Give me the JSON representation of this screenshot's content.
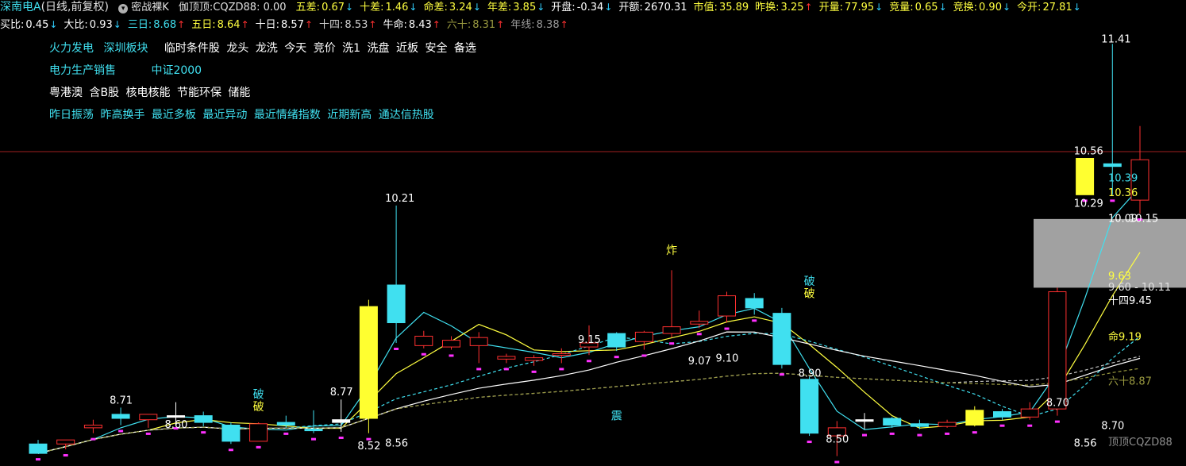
{
  "header": {
    "title": "深南电A",
    "period": "(日线,前复权)",
    "mode": "密战裸K",
    "formula_label": "伽顶顶:",
    "formula_value": "CQZD88: 0.00",
    "stats_row1": [
      {
        "label": "五差:",
        "value": "0.67",
        "dir": "down",
        "color": "#ffff40"
      },
      {
        "label": "十差:",
        "value": "1.46",
        "dir": "down",
        "color": "#ffff40"
      },
      {
        "label": "命差:",
        "value": "3.24",
        "dir": "down",
        "color": "#ffff40"
      },
      {
        "label": "年差:",
        "value": "3.85",
        "dir": "down",
        "color": "#ffff40"
      },
      {
        "label": "开盘:",
        "value": "-0.34",
        "dir": "down",
        "color": "#ffffff"
      },
      {
        "label": "开额:",
        "value": "2670.31",
        "dir": "",
        "color": "#ffffff"
      },
      {
        "label": "市值:",
        "value": "35.89",
        "dir": "",
        "color": "#ffff40"
      },
      {
        "label": "昨换:",
        "value": "3.25",
        "dir": "up",
        "color": "#ffff40"
      },
      {
        "label": "开量:",
        "value": "77.95",
        "dir": "down",
        "color": "#ffff40"
      },
      {
        "label": "竞量:",
        "value": "0.65",
        "dir": "down",
        "color": "#ffff40"
      },
      {
        "label": "竞换:",
        "value": "0.90",
        "dir": "down",
        "color": "#ffff40"
      },
      {
        "label": "今开:",
        "value": "27.81",
        "dir": "down",
        "color": "#ffff40"
      }
    ],
    "stats_row2": [
      {
        "label": "买比:",
        "value": "0.45",
        "dir": "down",
        "color": "#ffffff"
      },
      {
        "label": "大比:",
        "value": "0.93",
        "dir": "down",
        "color": "#ffffff"
      },
      {
        "label": "三日:",
        "value": "8.68",
        "dir": "up",
        "color": "#40e0f0"
      },
      {
        "label": "五日:",
        "value": "8.64",
        "dir": "up",
        "color": "#ffff40"
      },
      {
        "label": "十日:",
        "value": "8.57",
        "dir": "up",
        "color": "#ffffff"
      },
      {
        "label": "十四:",
        "value": "8.53",
        "dir": "up",
        "color": "#d0d0d0"
      },
      {
        "label": "牛命:",
        "value": "8.43",
        "dir": "up",
        "color": "#ffffff"
      },
      {
        "label": "六十:",
        "value": "8.31",
        "dir": "up",
        "color": "#9a9a40"
      },
      {
        "label": "年线:",
        "value": "8.38",
        "dir": "up",
        "color": "#9a9a9a"
      }
    ]
  },
  "tags": {
    "line1_cyan": [
      "火力发电",
      "深圳板块"
    ],
    "line1_white": [
      "临时条件股",
      "龙头",
      "龙洗",
      "今天",
      "竞价",
      "洗1",
      "洗盘",
      "近板",
      "安全",
      "备选"
    ],
    "line2_cyan": [
      "电力生产销售",
      "中证2000"
    ],
    "line3_white": [
      "粤港澳",
      "含B股",
      "核电核能",
      "节能环保",
      "储能"
    ],
    "line4_cyan": [
      "昨日振荡",
      "昨高换手",
      "最近多板",
      "最近异动",
      "最近情绪指数",
      "近期新高",
      "通达信热股"
    ]
  },
  "chart_data": {
    "type": "candlestick",
    "ylim": [
      8.3,
      11.5
    ],
    "candles": [
      {
        "o": 8.44,
        "h": 8.47,
        "l": 8.37,
        "c": 8.37,
        "color": "cyan"
      },
      {
        "o": 8.44,
        "h": 8.47,
        "l": 8.4,
        "c": 8.47,
        "color": "red"
      },
      {
        "o": 8.56,
        "h": 8.62,
        "l": 8.52,
        "c": 8.58,
        "color": "red"
      },
      {
        "o": 8.66,
        "h": 8.71,
        "l": 8.58,
        "c": 8.63,
        "color": "cyan"
      },
      {
        "o": 8.62,
        "h": 8.66,
        "l": 8.56,
        "c": 8.66,
        "color": "red"
      },
      {
        "o": 8.65,
        "h": 8.75,
        "l": 8.6,
        "c": 8.64,
        "color": "white"
      },
      {
        "o": 8.65,
        "h": 8.68,
        "l": 8.57,
        "c": 8.6,
        "color": "cyan"
      },
      {
        "o": 8.58,
        "h": 8.6,
        "l": 8.44,
        "c": 8.46,
        "color": "cyan"
      },
      {
        "o": 8.46,
        "h": 8.6,
        "l": 8.46,
        "c": 8.59,
        "color": "red"
      },
      {
        "o": 8.6,
        "h": 8.65,
        "l": 8.56,
        "c": 8.58,
        "color": "cyan"
      },
      {
        "o": 8.55,
        "h": 8.69,
        "l": 8.52,
        "c": 8.55,
        "color": "cyan"
      },
      {
        "o": 8.62,
        "h": 8.77,
        "l": 8.53,
        "c": 8.6,
        "color": "white"
      },
      {
        "o": 8.63,
        "h": 9.51,
        "l": 8.52,
        "c": 9.46,
        "color": "yellow"
      },
      {
        "o": 9.34,
        "h": 10.21,
        "l": 9.19,
        "c": 9.62,
        "color": "cyan"
      },
      {
        "o": 9.24,
        "h": 9.28,
        "l": 9.15,
        "c": 9.17,
        "color": "red"
      },
      {
        "o": 9.21,
        "h": 9.24,
        "l": 9.14,
        "c": 9.16,
        "color": "red"
      },
      {
        "o": 9.17,
        "h": 9.27,
        "l": 9.04,
        "c": 9.23,
        "color": "red"
      },
      {
        "o": 9.09,
        "h": 9.11,
        "l": 9.04,
        "c": 9.07,
        "color": "red"
      },
      {
        "o": 9.08,
        "h": 9.1,
        "l": 9.02,
        "c": 9.06,
        "color": "red"
      },
      {
        "o": 9.1,
        "h": 9.15,
        "l": 9.04,
        "c": 9.11,
        "color": "red"
      },
      {
        "o": 9.16,
        "h": 9.32,
        "l": 9.1,
        "c": 9.19,
        "color": "red"
      },
      {
        "o": 9.16,
        "h": 9.27,
        "l": 9.13,
        "c": 9.26,
        "color": "cyan"
      },
      {
        "o": 9.2,
        "h": 9.28,
        "l": 9.14,
        "c": 9.27,
        "color": "red"
      },
      {
        "o": 9.26,
        "h": 9.73,
        "l": 9.23,
        "c": 9.31,
        "color": "red"
      },
      {
        "o": 9.33,
        "h": 9.43,
        "l": 9.3,
        "c": 9.35,
        "color": "red"
      },
      {
        "o": 9.39,
        "h": 9.57,
        "l": 9.34,
        "c": 9.54,
        "color": "red"
      },
      {
        "o": 9.52,
        "h": 9.56,
        "l": 9.4,
        "c": 9.45,
        "color": "cyan"
      },
      {
        "o": 9.41,
        "h": 9.45,
        "l": 9.0,
        "c": 9.03,
        "color": "cyan"
      },
      {
        "o": 8.92,
        "h": 8.94,
        "l": 8.5,
        "c": 8.52,
        "color": "cyan"
      },
      {
        "o": 8.56,
        "h": 8.61,
        "l": 8.35,
        "c": 8.5,
        "color": "red"
      },
      {
        "o": 8.62,
        "h": 8.67,
        "l": 8.55,
        "c": 8.62,
        "color": "white"
      },
      {
        "o": 8.63,
        "h": 8.64,
        "l": 8.56,
        "c": 8.58,
        "color": "cyan"
      },
      {
        "o": 8.59,
        "h": 8.62,
        "l": 8.55,
        "c": 8.57,
        "color": "cyan"
      },
      {
        "o": 8.57,
        "h": 8.62,
        "l": 8.56,
        "c": 8.6,
        "color": "red"
      },
      {
        "o": 8.58,
        "h": 8.72,
        "l": 8.57,
        "c": 8.69,
        "color": "yellow"
      },
      {
        "o": 8.68,
        "h": 8.7,
        "l": 8.62,
        "c": 8.64,
        "color": "cyan"
      },
      {
        "o": 8.64,
        "h": 8.75,
        "l": 8.62,
        "c": 8.7,
        "color": "red"
      },
      {
        "o": 8.7,
        "h": 9.6,
        "l": 8.65,
        "c": 9.57,
        "color": "red"
      },
      {
        "o": 10.56,
        "h": 10.56,
        "l": 10.29,
        "c": 10.29,
        "color": "yellow"
      },
      {
        "o": 10.52,
        "h": 11.41,
        "l": 10.29,
        "c": 10.5,
        "color": "cyan"
      },
      {
        "o": 10.55,
        "h": 10.8,
        "l": 10.15,
        "c": 10.25,
        "color": "red"
      }
    ],
    "price_labels": [
      {
        "text": "8.71",
        "candle": 3,
        "y": 8.74
      },
      {
        "text": "8.60",
        "candle": 5,
        "y": 8.56
      },
      {
        "text": "8.77",
        "candle": 11,
        "y": 8.8
      },
      {
        "text": "8.52",
        "candle": 12,
        "y": 8.4
      },
      {
        "text": "8.56",
        "candle": 13,
        "y": 8.42
      },
      {
        "text": "10.21",
        "candle": 13,
        "y": 10.24
      },
      {
        "text": "9.15",
        "candle": 20,
        "y": 9.19
      },
      {
        "text": "9.07",
        "candle": 24,
        "y": 9.03
      },
      {
        "text": "9.10",
        "candle": 25,
        "y": 9.05
      },
      {
        "text": "8.90",
        "candle": 28,
        "y": 8.94
      },
      {
        "text": "8.50",
        "candle": 29,
        "y": 8.45
      },
      {
        "text": "8.70",
        "candle": 37,
        "y": 8.72
      },
      {
        "text": "8.56",
        "candle": 38,
        "y": 8.42
      },
      {
        "text": "8.70",
        "candle": 39,
        "y": 8.55
      },
      {
        "text": "10.56",
        "candle": 38,
        "y": 10.59
      },
      {
        "text": "10.29",
        "candle": 38,
        "y": 10.2
      },
      {
        "text": "11.41",
        "candle": 39,
        "y": 11.42
      },
      {
        "text": "10.15",
        "candle": 40,
        "y": 10.09
      }
    ],
    "signals": [
      {
        "text": "破",
        "candle": 8,
        "y": 8.78,
        "color": "#40e0f0"
      },
      {
        "text": "破",
        "candle": 8,
        "y": 8.69,
        "color": "#ffff40"
      },
      {
        "text": "炸",
        "candle": 23,
        "y": 9.85,
        "color": "#ffff40"
      },
      {
        "text": "破",
        "candle": 28,
        "y": 9.62,
        "color": "#40e0f0"
      },
      {
        "text": "破",
        "candle": 28,
        "y": 9.53,
        "color": "#ffff40"
      },
      {
        "text": "震",
        "candle": 21,
        "y": 8.62,
        "color": "#40e0f0"
      }
    ],
    "ma_lines": [
      {
        "name": "三日",
        "color": "#40e0f0",
        "dash": false
      },
      {
        "name": "五日",
        "color": "#ffff40",
        "dash": false
      },
      {
        "name": "十日",
        "color": "#40e0f0",
        "dash": true
      },
      {
        "name": "十四",
        "color": "#ffffff",
        "dash": false
      },
      {
        "name": "牛命",
        "color": "#c0c0c0",
        "dash": true
      },
      {
        "name": "六十",
        "color": "#9a9a40",
        "dash": true
      }
    ],
    "right_labels": [
      {
        "text": "10.39",
        "y": 10.39,
        "color": "#40e0f0"
      },
      {
        "text": "10.36",
        "y": 10.28,
        "color": "#ffff40"
      },
      {
        "text": "10.09",
        "y": 10.09,
        "color": "#ffffff"
      },
      {
        "text": "9.60 - 10.11",
        "y": 9.58,
        "color": "#e0e0e0"
      },
      {
        "text": "9.63",
        "y": 9.66,
        "color": "#ffff40"
      },
      {
        "text": "十四9.45",
        "y": 9.48,
        "color": "#ffffff"
      },
      {
        "text": "命9.19",
        "y": 9.21,
        "color": "#ffff40"
      },
      {
        "text": "六十8.87",
        "y": 8.88,
        "color": "#9a9a40"
      },
      {
        "text": "顶顶CQZD88",
        "y": 8.43,
        "color": "#909090"
      }
    ],
    "gray_zone": [
      9.6,
      10.11
    ],
    "hline_y": 10.61
  }
}
